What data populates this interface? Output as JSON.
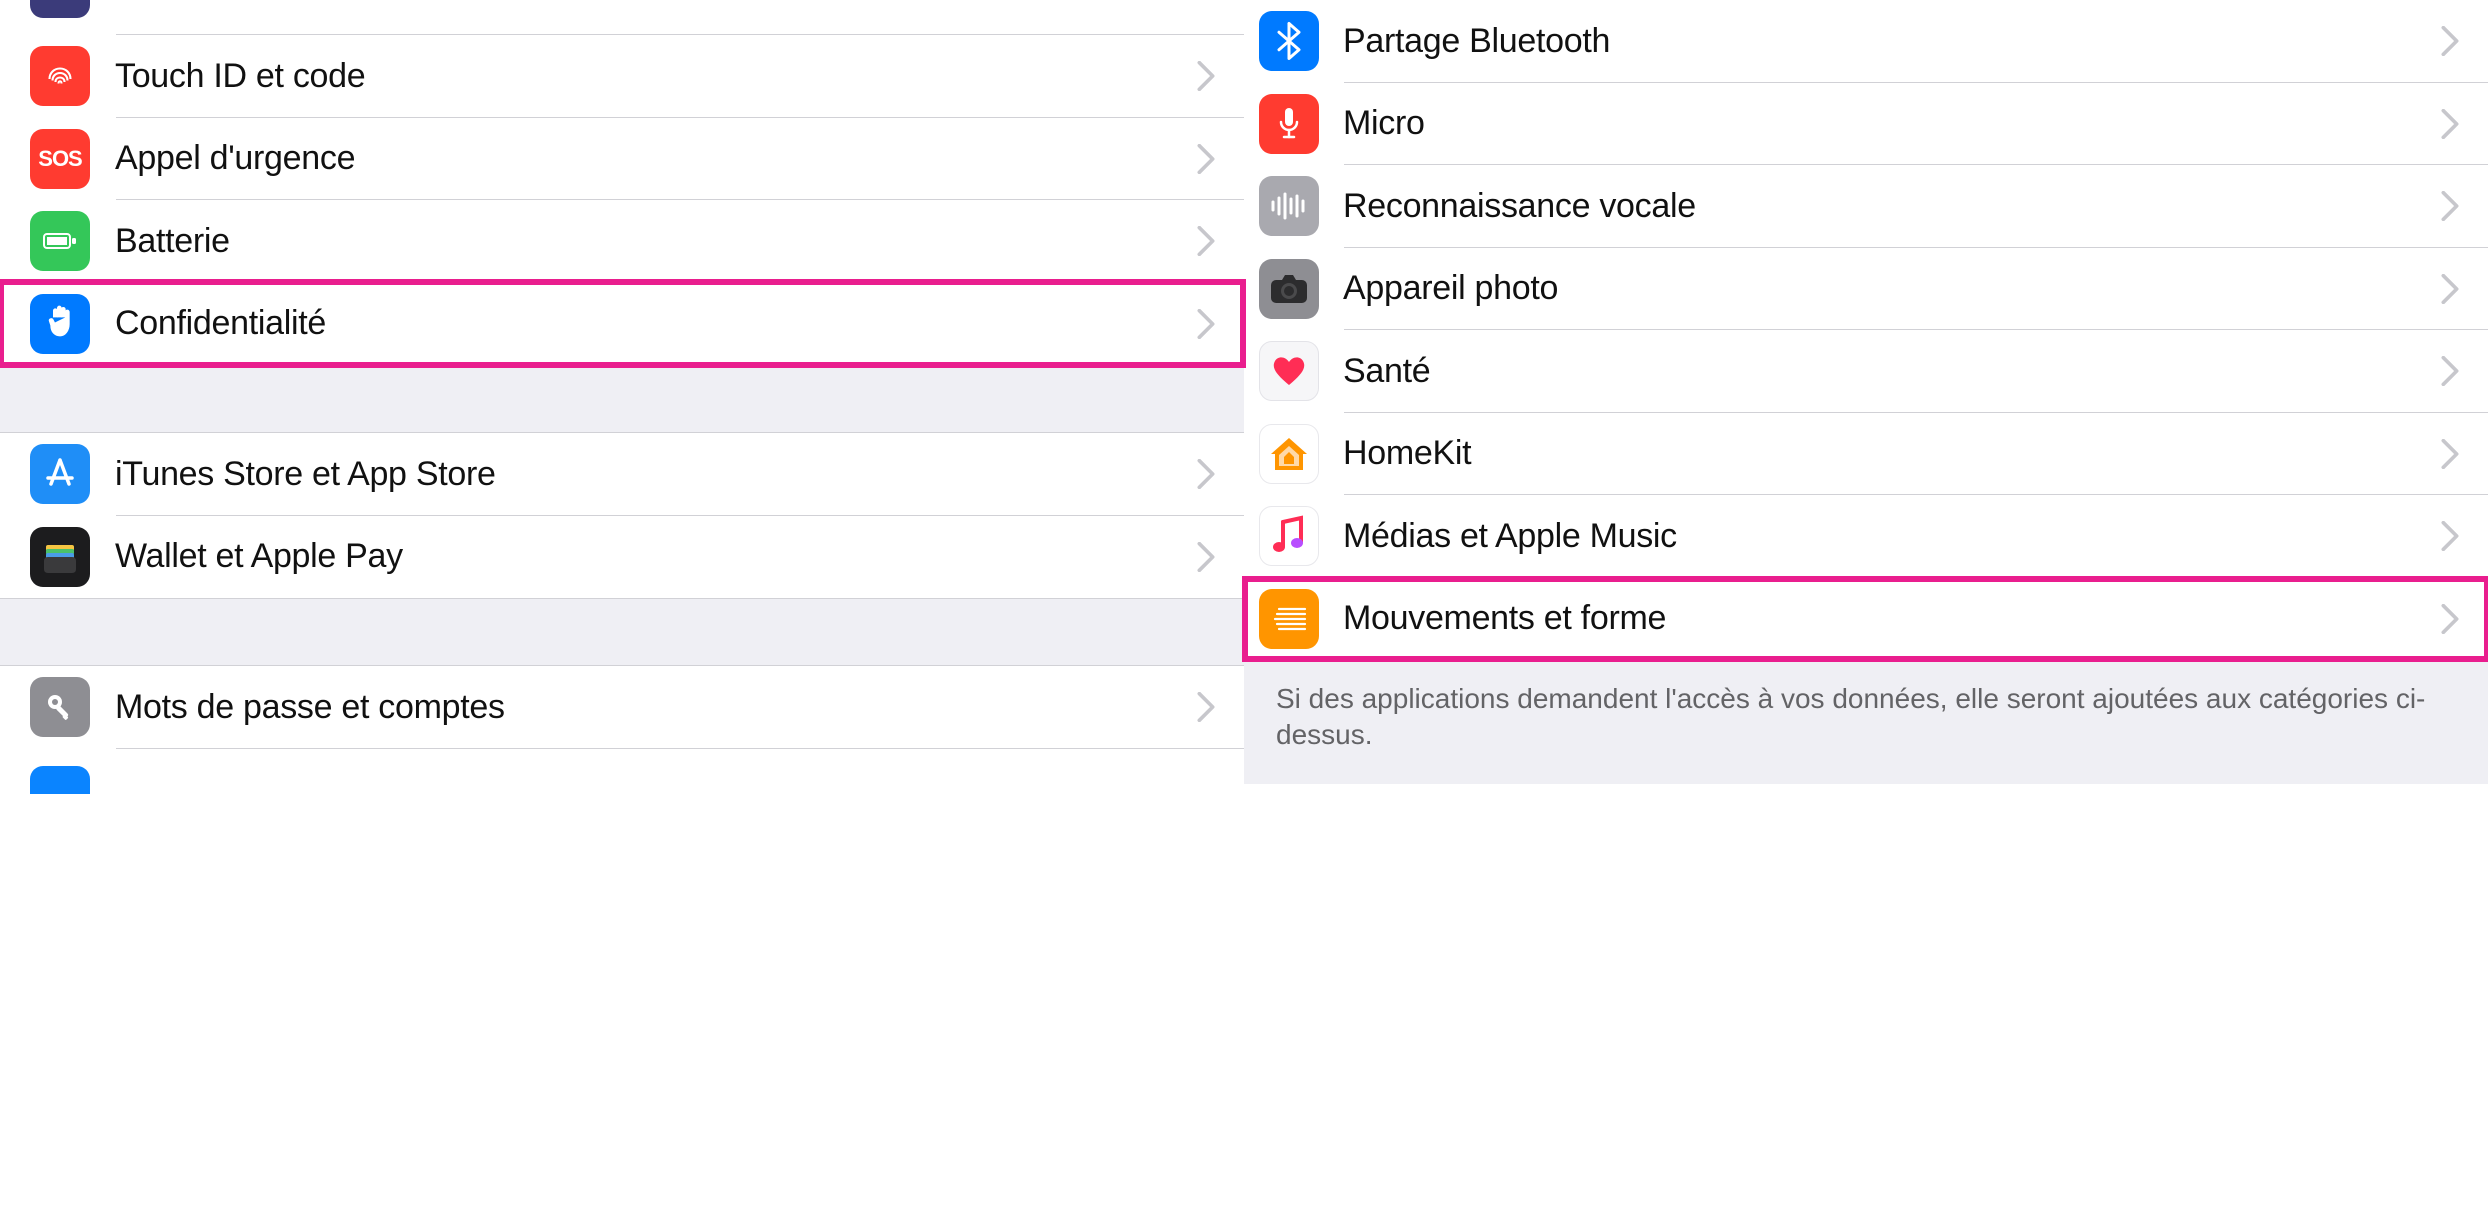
{
  "left": {
    "groups": [
      {
        "items": [
          {
            "id": "touch-id",
            "label": "Touch ID et code",
            "icon": "touchid"
          },
          {
            "id": "emergency-sos",
            "label": "Appel d'urgence",
            "icon": "sos"
          },
          {
            "id": "battery",
            "label": "Batterie",
            "icon": "battery"
          },
          {
            "id": "privacy",
            "label": "Confidentialité",
            "icon": "hand",
            "highlighted": true
          }
        ]
      },
      {
        "items": [
          {
            "id": "itunes-appstore",
            "label": "iTunes Store et App Store",
            "icon": "appstore"
          },
          {
            "id": "wallet-applepay",
            "label": "Wallet et Apple Pay",
            "icon": "wallet"
          }
        ]
      },
      {
        "items": [
          {
            "id": "passwords-accounts",
            "label": "Mots de passe et comptes",
            "icon": "key"
          }
        ]
      }
    ]
  },
  "right": {
    "items": [
      {
        "id": "bluetooth-sharing",
        "label": "Partage Bluetooth",
        "icon": "bt"
      },
      {
        "id": "microphone",
        "label": "Micro",
        "icon": "mic"
      },
      {
        "id": "speech-recognition",
        "label": "Reconnaissance vocale",
        "icon": "voice"
      },
      {
        "id": "camera",
        "label": "Appareil photo",
        "icon": "camera"
      },
      {
        "id": "health",
        "label": "Santé",
        "icon": "health"
      },
      {
        "id": "homekit",
        "label": "HomeKit",
        "icon": "homekit"
      },
      {
        "id": "media-applemusic",
        "label": "Médias et Apple Music",
        "icon": "music"
      },
      {
        "id": "motion-fitness",
        "label": "Mouvements et forme",
        "icon": "motion",
        "highlighted": true
      }
    ],
    "footer_note": "Si des applications demandent l'accès à vos données, elle seront ajoutées aux catégories ci-dessus."
  }
}
